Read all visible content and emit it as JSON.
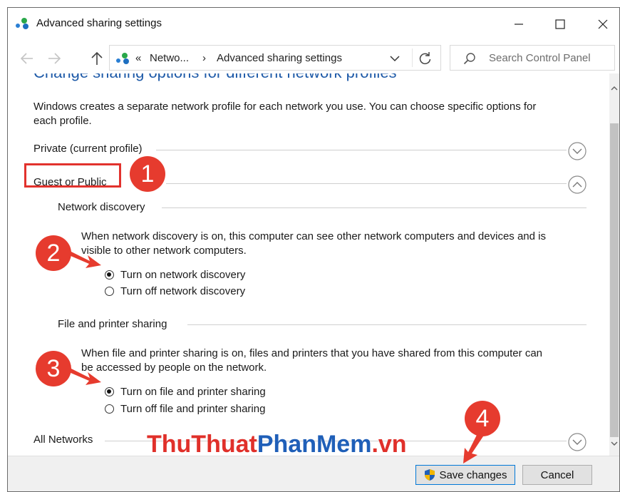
{
  "window": {
    "title": "Advanced sharing settings"
  },
  "address_bar": {
    "overflow": "«",
    "crumb_1": "Netwo...",
    "separator": "›",
    "crumb_2": "Advanced sharing settings"
  },
  "search": {
    "placeholder": "Search Control Panel"
  },
  "content": {
    "heading": "Change sharing options for different network profiles",
    "intro_line1": "Windows creates a separate network profile for each network you use. You can choose specific options for",
    "intro_line2": "each profile.",
    "private_profile": "Private (current profile)",
    "guest_public": "Guest or Public",
    "all_networks": "All Networks"
  },
  "network_discovery": {
    "title": "Network discovery",
    "desc_line1": "When network discovery is on, this computer can see other network computers and devices and is",
    "desc_line2": "visible to other network computers.",
    "on_label": "Turn on network discovery",
    "off_label": "Turn off network discovery",
    "selected": "on"
  },
  "file_printer_sharing": {
    "title": "File and printer sharing",
    "desc_line1": "When file and printer sharing is on, files and printers that you have shared from this computer can",
    "desc_line2": "be accessed by people on the network.",
    "on_label": "Turn on file and printer sharing",
    "off_label": "Turn off file and printer sharing",
    "selected": "on"
  },
  "footer": {
    "save_label": "Save changes",
    "cancel_label": "Cancel"
  },
  "watermark": {
    "part1": "ThuThuat",
    "part2": "PhanMem",
    "part3": ".vn"
  },
  "annotations": {
    "step1": "1",
    "step2": "2",
    "step3": "3",
    "step4": "4"
  },
  "colors": {
    "accent_blue": "#1e5aa8",
    "annotation_red": "#e63b2e",
    "watermark_red": "#e0302a",
    "watermark_blue": "#1f5fb8"
  }
}
